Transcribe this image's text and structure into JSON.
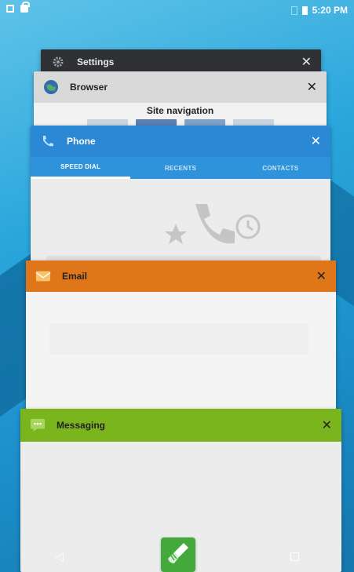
{
  "statusbar": {
    "time": "5:20 PM"
  },
  "cards": {
    "settings": {
      "title": "Settings",
      "close": "✕"
    },
    "browser": {
      "title": "Browser",
      "close": "✕",
      "page_title": "Site navigation"
    },
    "phone": {
      "title": "Phone",
      "close": "✕",
      "tabs": [
        "SPEED DIAL",
        "RECENTS",
        "CONTACTS"
      ],
      "active_tab": "SPEED DIAL"
    },
    "email": {
      "title": "Email",
      "close": "✕"
    },
    "messaging": {
      "title": "Messaging",
      "close": "✕"
    }
  },
  "navbar": {
    "back": "◁"
  },
  "colors": {
    "settings": "#2f3134",
    "browser": "#d9d9d9",
    "phone": "#2a88d4",
    "email": "#e0761a",
    "messaging": "#7bb51d",
    "clean_button": "#43a93b"
  },
  "icons": {
    "statusbar_left": [
      "screenshot-icon",
      "lock-icon"
    ],
    "statusbar_right": [
      "sim-icon",
      "battery-icon"
    ],
    "settings": "gear-icon",
    "browser": "globe-icon",
    "phone": "phone-icon",
    "email": "envelope-icon",
    "messaging": "chat-bubble-icon",
    "clean": "broom-icon"
  }
}
